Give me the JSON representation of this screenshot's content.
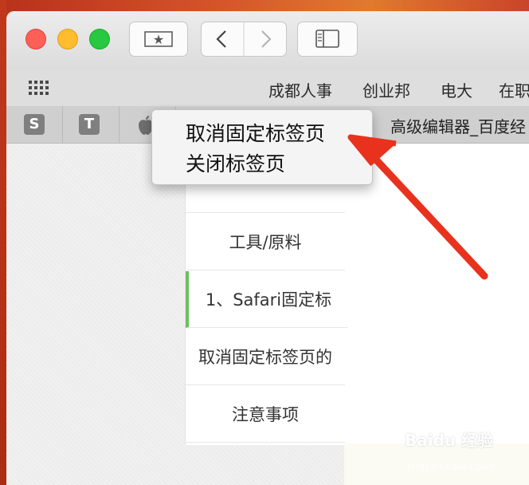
{
  "window": {
    "favorites": [
      "成都人事",
      "创业邦",
      "电大",
      "在职"
    ]
  },
  "tabs": {
    "pinned": [
      "S",
      "T"
    ],
    "active_title": "高级编辑器_百度经"
  },
  "context_menu": {
    "items": [
      "取消固定标签页",
      "关闭标签页"
    ]
  },
  "toc": {
    "items": [
      "工具/原料",
      "1、Safari固定标",
      "取消固定标签页的",
      "注意事项"
    ],
    "active_index": 1
  },
  "watermark": {
    "brand": "Baidu 经验",
    "url": "jingyan.baidu.com"
  },
  "colors": {
    "close": "#fe5f57",
    "minimize": "#febc2e",
    "zoom": "#28c840",
    "toc_accent": "#6bbf5e",
    "annotation_arrow": "#e8321e"
  }
}
